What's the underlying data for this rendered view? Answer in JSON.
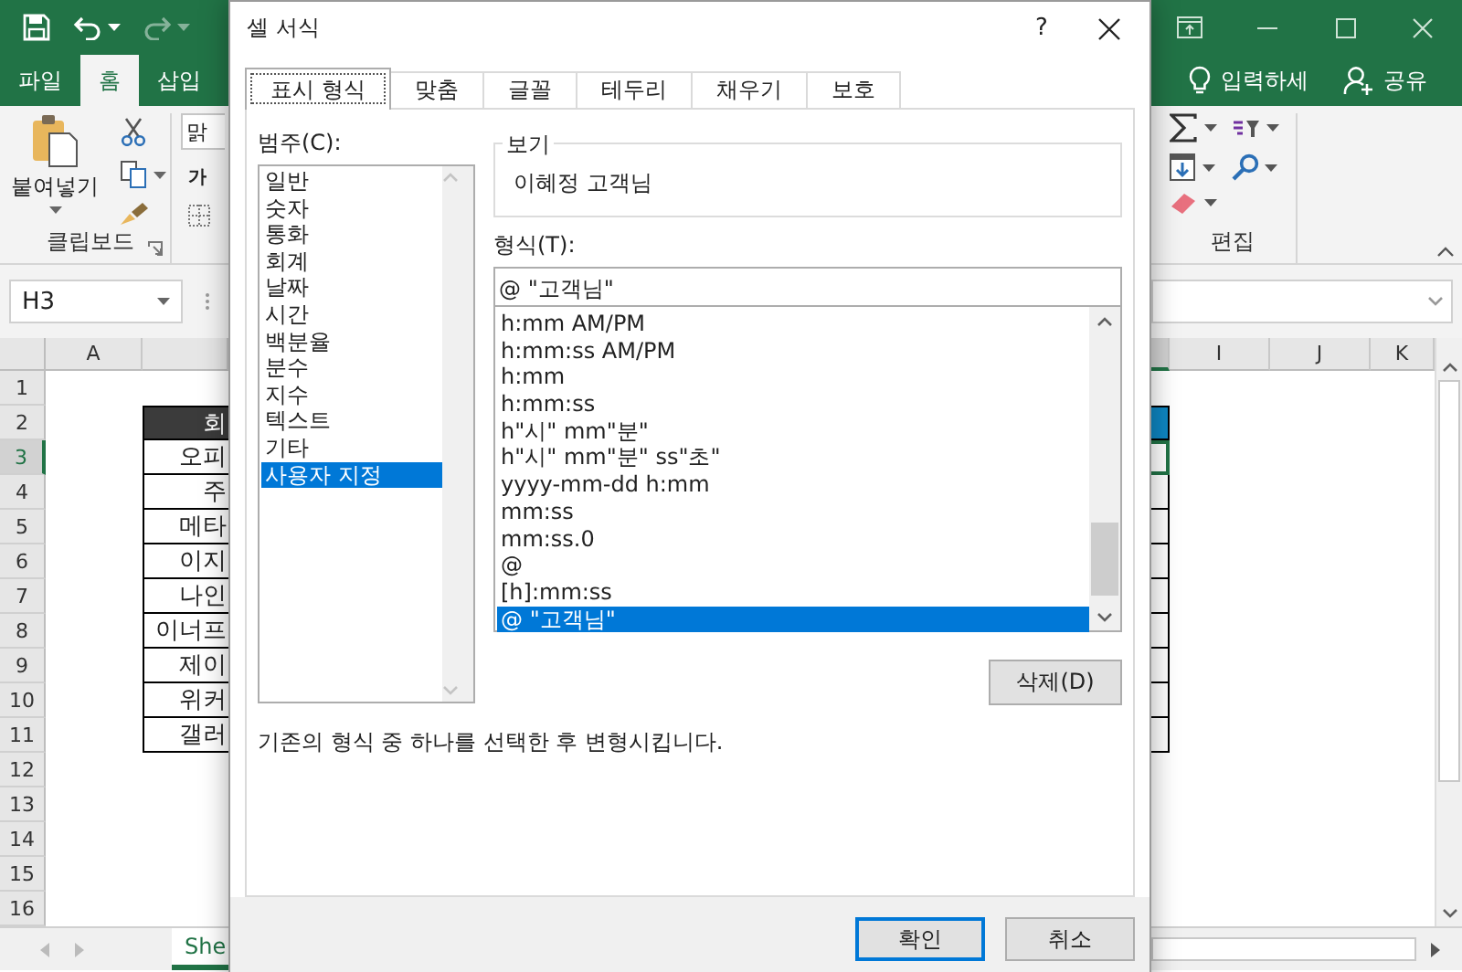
{
  "excel": {
    "ribbon_tabs": [
      {
        "label": "파일",
        "selected": false
      },
      {
        "label": "홈",
        "selected": true
      },
      {
        "label": "삽입",
        "selected": false
      }
    ],
    "tell_me": "입력하세",
    "share": "공유",
    "clipboard": {
      "paste": "붙여넣기",
      "group_label": "클립보드"
    },
    "font": {
      "name_field": "맑",
      "bold_label": "가"
    },
    "editing": {
      "group_label": "편집"
    },
    "name_box": "H3",
    "columns_left": [
      "A"
    ],
    "columns_right": [
      "I",
      "J",
      "K"
    ],
    "rows": [
      {
        "label": "1",
        "selected": false
      },
      {
        "label": "2",
        "selected": false
      },
      {
        "label": "3",
        "selected": true
      },
      {
        "label": "4",
        "selected": false
      },
      {
        "label": "5",
        "selected": false
      },
      {
        "label": "6",
        "selected": false
      },
      {
        "label": "7",
        "selected": false
      },
      {
        "label": "8",
        "selected": false
      },
      {
        "label": "9",
        "selected": false
      },
      {
        "label": "10",
        "selected": false
      },
      {
        "label": "11",
        "selected": false
      },
      {
        "label": "12",
        "selected": false
      },
      {
        "label": "13",
        "selected": false
      },
      {
        "label": "14",
        "selected": false
      },
      {
        "label": "15",
        "selected": false
      },
      {
        "label": "16",
        "selected": false
      }
    ],
    "table": {
      "header": "회",
      "cells": [
        "오피",
        "주",
        "메타",
        "이지",
        "나인",
        "이너프",
        "제이",
        "위커",
        "갤러"
      ]
    },
    "sheet_tab": "She"
  },
  "dialog": {
    "title": "셀 서식",
    "help": "?",
    "tabs": [
      {
        "label": "표시 형식",
        "selected": true
      },
      {
        "label": "맞춤",
        "selected": false
      },
      {
        "label": "글꼴",
        "selected": false
      },
      {
        "label": "테두리",
        "selected": false
      },
      {
        "label": "채우기",
        "selected": false
      },
      {
        "label": "보호",
        "selected": false
      }
    ],
    "category_label": "범주(C):",
    "categories": [
      {
        "label": "일반",
        "selected": false
      },
      {
        "label": "숫자",
        "selected": false
      },
      {
        "label": "통화",
        "selected": false
      },
      {
        "label": "회계",
        "selected": false
      },
      {
        "label": "날짜",
        "selected": false
      },
      {
        "label": "시간",
        "selected": false
      },
      {
        "label": "백분율",
        "selected": false
      },
      {
        "label": "분수",
        "selected": false
      },
      {
        "label": "지수",
        "selected": false
      },
      {
        "label": "텍스트",
        "selected": false
      },
      {
        "label": "기타",
        "selected": false
      },
      {
        "label": "사용자 지정",
        "selected": true
      }
    ],
    "preview_label": "보기",
    "preview": "이혜정 고객님",
    "format_label": "형식(T):",
    "format_value": "@ \"고객님\"",
    "formats": [
      {
        "label": "h:mm AM/PM",
        "selected": false
      },
      {
        "label": "h:mm:ss AM/PM",
        "selected": false
      },
      {
        "label": "h:mm",
        "selected": false
      },
      {
        "label": "h:mm:ss",
        "selected": false
      },
      {
        "label": "h\"시\" mm\"분\"",
        "selected": false
      },
      {
        "label": "h\"시\" mm\"분\" ss\"초\"",
        "selected": false
      },
      {
        "label": "yyyy-mm-dd h:mm",
        "selected": false
      },
      {
        "label": "mm:ss",
        "selected": false
      },
      {
        "label": "mm:ss.0",
        "selected": false
      },
      {
        "label": "@",
        "selected": false
      },
      {
        "label": "[h]:mm:ss",
        "selected": false
      },
      {
        "label": "@ \"고객님\"",
        "selected": true
      }
    ],
    "delete_button": "삭제(D)",
    "description": "기존의 형식 중 하나를 선택한 후 변형시킵니다.",
    "buttons": [
      "확인",
      "취소"
    ]
  }
}
